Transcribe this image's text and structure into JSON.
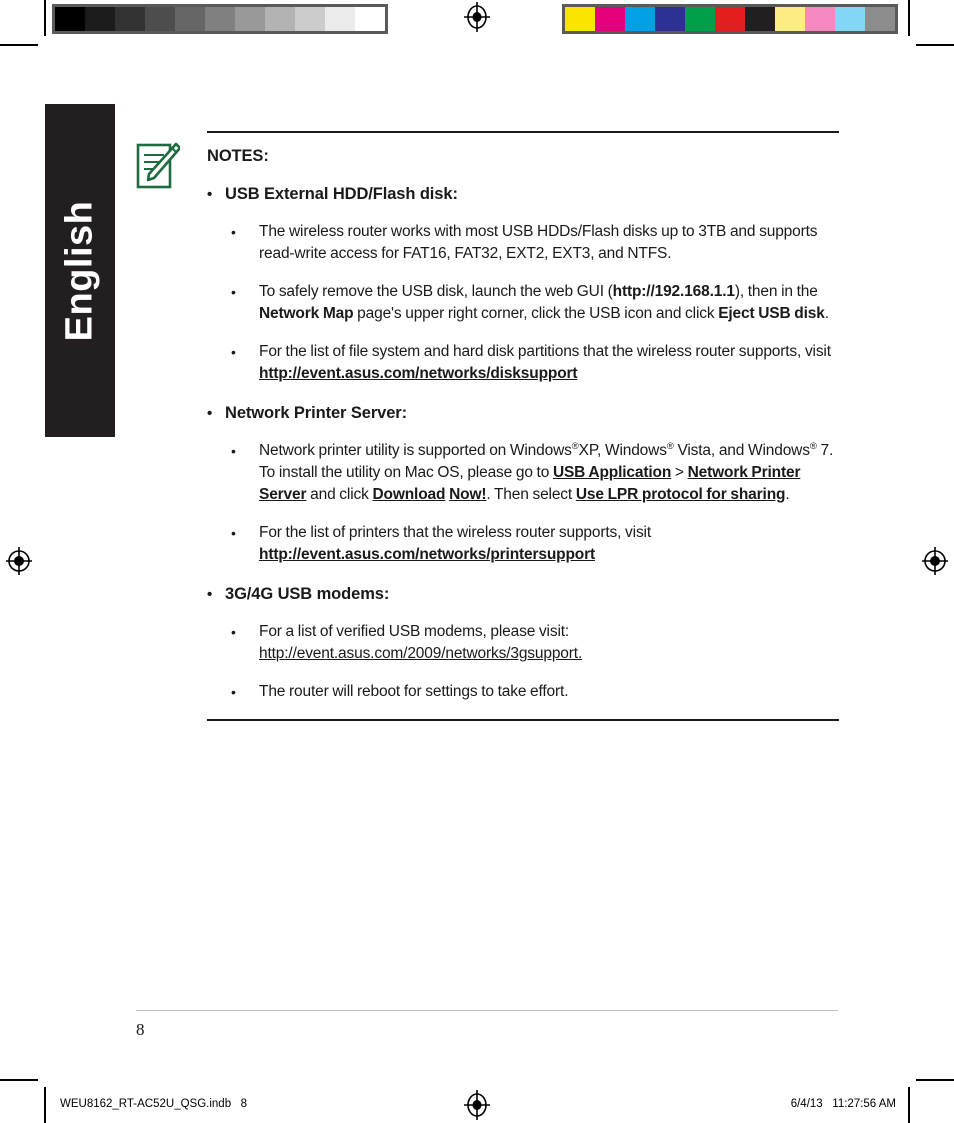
{
  "page": {
    "language_tab": "English",
    "page_number": "8"
  },
  "calibration": {
    "grayscale_bar": {
      "name": "grayscale-calibration-bar",
      "swatches": [
        "#000000",
        "#1c1c1c",
        "#333333",
        "#4d4d4d",
        "#666666",
        "#808080",
        "#999999",
        "#b3b3b3",
        "#cccccc",
        "#ebebeb",
        "#ffffff"
      ]
    },
    "color_bar": {
      "name": "color-calibration-bar",
      "swatches": [
        "#fbe500",
        "#e5007d",
        "#00a0e4",
        "#2e3192",
        "#00a04b",
        "#e41e1e",
        "#231f20",
        "#fbec84",
        "#f489c0",
        "#84d6f7",
        "#8c8c8c"
      ]
    }
  },
  "notes": {
    "icon": "note-pencil-icon",
    "title": "NOTES:",
    "bullet_marker": "•",
    "sub_bullet_marker": "•",
    "sections": [
      {
        "heading": "USB External HDD/Flash disk:",
        "items": [
          "The wireless router works with most USB HDDs/Flash disks up to 3TB and supports read-write access for FAT16, FAT32, EXT2, EXT3, and NTFS.",
          "To safely remove the USB disk, launch the web GUI (http://192.168.1.1), then in the Network Map page's upper right corner, click the USB icon and click Eject USB disk.",
          "For the list of file system and hard disk partitions that the wireless router supports, visit http://event.asus.com/networks/disksupport"
        ]
      },
      {
        "heading": "Network Printer Server:",
        "items": [
          "Network printer utility is supported on Windows®XP, Windows® Vista, and Windows® 7. To install the utility on Mac OS, please go to USB Application > Network Printer Server and click Download Now!. Then select Use LPR protocol for sharing.",
          "For the list of printers that the wireless router supports, visit http://event.asus.com/networks/printersupport"
        ]
      },
      {
        "heading": "3G/4G USB modems:",
        "items": [
          "For a list of verified USB modems, please visit: http://event.asus.com/2009/networks/3gsupport.",
          "The router will reboot for settings to take effort."
        ]
      }
    ],
    "inline": {
      "router_ip_url": "http://192.168.1.1",
      "network_map": "Network Map",
      "eject_usb_disk": "Eject USB disk",
      "disksupport_url_line1": "http://event.asus.com/networks/",
      "disksupport_url_line2": "disksupport",
      "usb_application": "USB Application",
      "network_printer_server": "Network Printer Server",
      "download_now_line1": "Download",
      "download_now_line2": "Now!",
      "use_lpr": "Use LPR protocol for sharing",
      "printersupport_url": "http://event.asus.com/networks/printersupport",
      "gsupport_url": "http://event.asus.com/2009/networks/3gsupport."
    }
  },
  "footer": {
    "file_name": "WEU8162_RT-AC52U_QSG.indb   8",
    "timestamp": "6/4/13   11:27:56 AM"
  }
}
